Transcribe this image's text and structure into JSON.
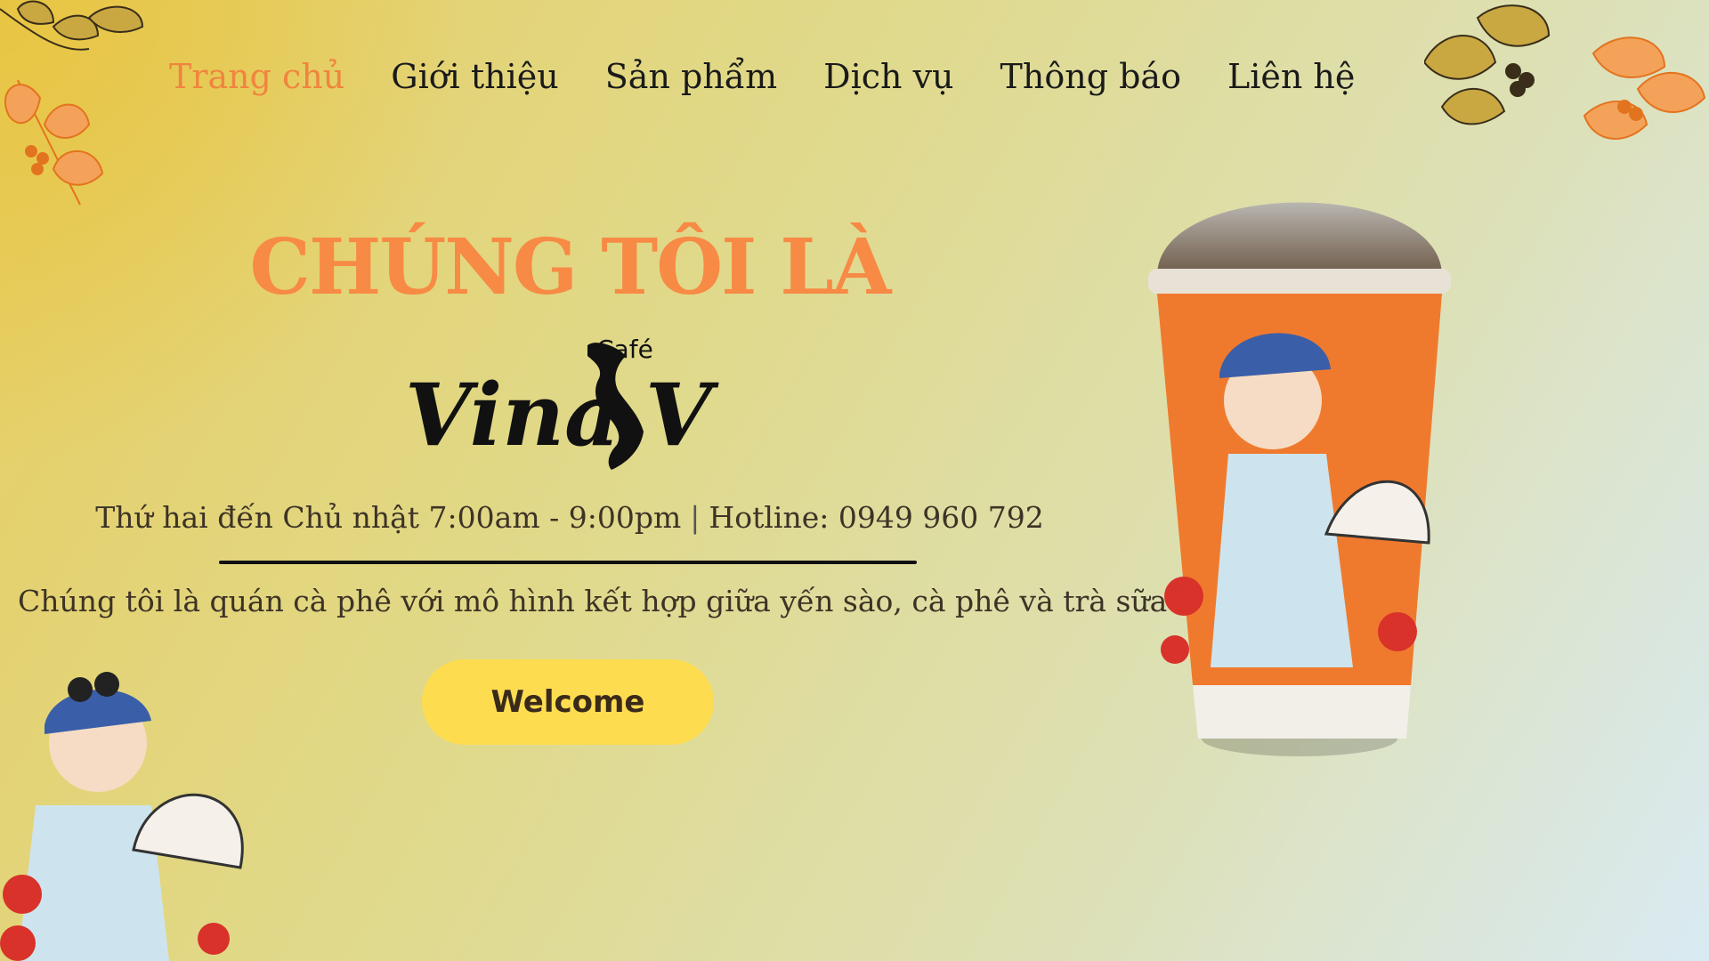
{
  "nav": {
    "items": [
      {
        "label": "Trang chủ",
        "active": true
      },
      {
        "label": "Giới thiệu",
        "active": false
      },
      {
        "label": "Sản phẩm",
        "active": false
      },
      {
        "label": "Dịch vụ",
        "active": false
      },
      {
        "label": "Thông báo",
        "active": false
      },
      {
        "label": "Liên hệ",
        "active": false
      }
    ]
  },
  "hero": {
    "kicker": "CHÚNG TÔI LÀ",
    "brand": {
      "name": "Vina3V",
      "tag": "Café"
    },
    "hours": "Thứ hai đến Chủ nhật 7:00am - 9:00pm",
    "separator": "|",
    "hotline": "Hotline: 0949 960 792",
    "description": "Chúng tôi là quán cà phê với mô hình kết hợp giữa yến sào, cà phê và trà sữa",
    "cta_label": "Welcome"
  },
  "colors": {
    "accent": "#f78a45",
    "nav_active": "#f0853e",
    "button": "#fddc50",
    "text_dark": "#3d3326"
  },
  "decor": {
    "top_left": "coffee-branch-illustration",
    "top_right": "coffee-branch-illustration",
    "right": "cup-with-girl-illustration",
    "bottom_left": "girl-with-fan-illustration"
  }
}
